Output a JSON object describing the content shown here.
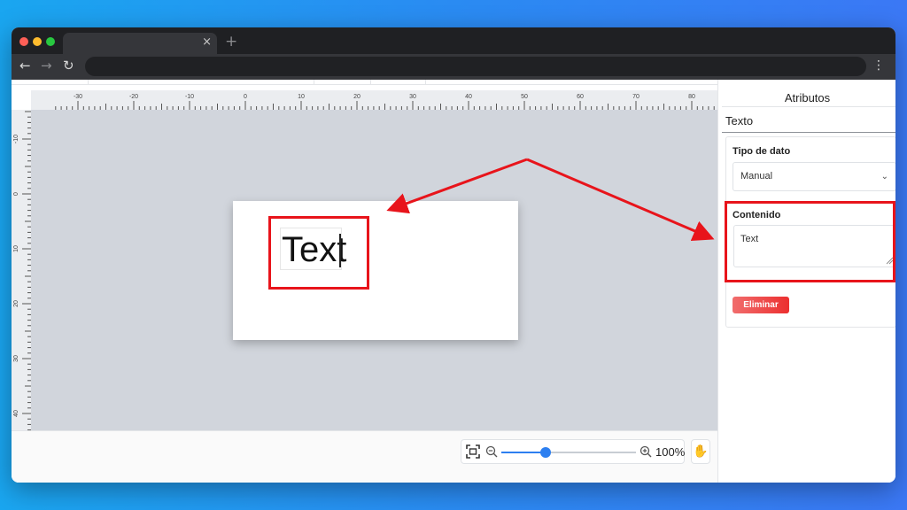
{
  "browser": {
    "tab_close": "×",
    "new_tab": "+",
    "back": "←",
    "forward": "→",
    "reload": "↻",
    "menu": "⋮"
  },
  "ruler": {
    "horizontal_labels": [
      "-30",
      "-20",
      "-10",
      "0",
      "10",
      "20",
      "30",
      "40",
      "50",
      "60",
      "70",
      "80"
    ],
    "vertical_labels": [
      "-10",
      "0",
      "10",
      "20",
      "30",
      "40"
    ]
  },
  "canvas": {
    "text_element": "Text"
  },
  "zoom": {
    "value_label": "100%",
    "level": 0.33
  },
  "panel": {
    "title": "Atributos",
    "element_name": "Texto",
    "data_type_label": "Tipo de dato",
    "data_type_value": "Manual",
    "content_label": "Contenido",
    "content_value": "Text",
    "delete_label": "Eliminar"
  },
  "annotation": {
    "color": "#e8141b"
  }
}
